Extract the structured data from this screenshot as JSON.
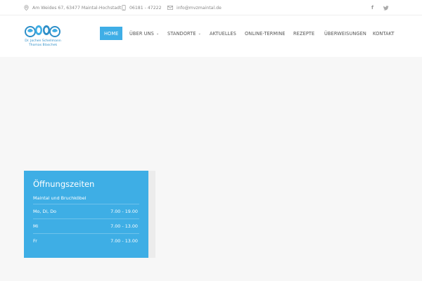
{
  "topbar": {
    "address": "Am Weides 67, 63477 Maintal-Hochstadt",
    "phone": "06181 - 47222",
    "email": "info@mvzmaintal.de",
    "social": {
      "facebook": "f",
      "twitter": "twitter-icon"
    }
  },
  "logo": {
    "line1": "Dr. Jochen Schellmann",
    "line2": "Thomas Blaschek"
  },
  "nav": {
    "home": "HOME",
    "ueber_uns": "ÜBER UNS",
    "standorte": "STANDORTE",
    "aktuelles": "AKTUELLES",
    "online_termine": "ONLINE-TERMINE",
    "rezepte": "REZEPTE",
    "ueberweisungen": "ÜBERWEISUNGEN",
    "kontakt": "KONTAKT",
    "caret": "⌄"
  },
  "hours": {
    "title": "Öffnungszeiten",
    "location": "Maintal und Bruchköbel",
    "rows": [
      {
        "days": "Mo, Di, Do",
        "time": "7.00 - 19.00"
      },
      {
        "days": "Mi",
        "time": "7.00 - 13.00"
      },
      {
        "days": "Fr",
        "time": "7.00 - 13.00"
      }
    ]
  },
  "colors": {
    "accent": "#3eaee5",
    "text": "#555555",
    "background": "#f7f7f7"
  }
}
